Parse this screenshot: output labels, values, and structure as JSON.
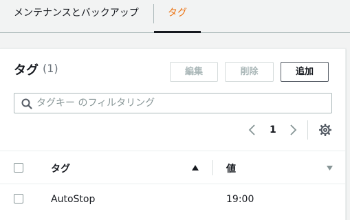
{
  "tabs": {
    "maintenance_label": "メンテナンスとバックアップ",
    "tags_label": "タグ"
  },
  "panel": {
    "title": "タグ",
    "count": "(1)",
    "buttons": {
      "edit": "編集",
      "delete": "削除",
      "add": "追加"
    },
    "search": {
      "placeholder": "タグキー のフィルタリング",
      "value": ""
    },
    "pagination": {
      "current_page": "1"
    }
  },
  "table": {
    "columns": [
      {
        "label": "タグ",
        "sort": "ascending"
      },
      {
        "label": "値",
        "sort": "none"
      }
    ],
    "rows": [
      {
        "key": "AutoStop",
        "value": "19:00"
      }
    ]
  },
  "colors": {
    "active_tab": "#ec7211",
    "text": "#16191f",
    "disabled": "#aab7b8",
    "border": "#879596",
    "background": "#f2f3f3"
  },
  "icons": [
    "search-icon",
    "chevron-left-icon",
    "chevron-right-icon",
    "gear-icon",
    "sort-ascending-icon",
    "sort-descending-icon"
  ]
}
